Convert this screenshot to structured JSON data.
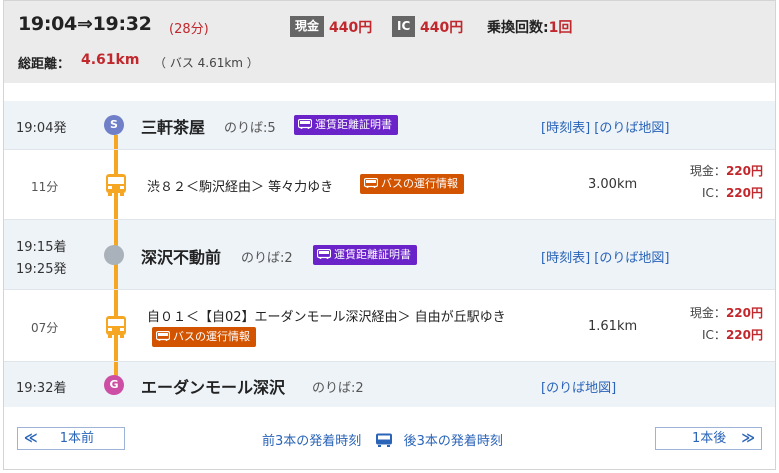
{
  "summary": {
    "time_range": "19:04⇒19:32",
    "duration": "(28分)",
    "cash_label": "現金",
    "cash_fare": "440円",
    "ic_label": "IC",
    "ic_fare": "440円",
    "transfers_label": "乗換回数:",
    "transfers_value": "1回",
    "distance_label": "総距離：",
    "distance_value": "4.61km",
    "distance_bus": "（ バス 4.61km ）"
  },
  "stops": [
    {
      "time": "19:04発",
      "node_letter": "S",
      "name": "三軒茶屋",
      "platform": "のりば:5",
      "badge": "運賃距離証明書",
      "links": "[時刻表] [のりば地図]"
    },
    {
      "time_arr": "19:15着",
      "time_dep": "19:25発",
      "name": "深沢不動前",
      "platform": "のりば:2",
      "badge": "運賃距離証明書",
      "links": "[時刻表] [のりば地図]"
    },
    {
      "time": "19:32着",
      "node_letter": "G",
      "name": "エーダンモール深沢",
      "platform": "のりば:2",
      "links": "[のりば地図]"
    }
  ],
  "rides": [
    {
      "minutes": "11分",
      "route": "渋８２＜駒沢経由＞ 等々力ゆき",
      "badge": "バスの運行情報",
      "distance": "3.00km",
      "cash_label": "現金：",
      "cash_fare": "220円",
      "ic_label": "IC：",
      "ic_fare": "220円"
    },
    {
      "minutes": "07分",
      "route": "自０１＜【自02】エーダンモール深沢経由＞ 自由が丘駅ゆき",
      "badge": "バスの運行情報",
      "distance": "1.61km",
      "cash_label": "現金：",
      "cash_fare": "220円",
      "ic_label": "IC：",
      "ic_fare": "220円"
    }
  ],
  "footer": {
    "prev_arrow": "≪",
    "prev_label": "1本前",
    "prev3": "前3本の発着時刻",
    "next3": "後3本の発着時刻",
    "next_label": "1本後",
    "next_arrow": "≫"
  },
  "colors": {
    "fare_red": "#c0282d",
    "link_blue": "#2a64b8",
    "bus_line": "#f5a623",
    "badge_purple": "#6a22c9",
    "badge_orange": "#d35400",
    "start_node": "#6f7fc8",
    "goal_node": "#cc4fa3"
  }
}
